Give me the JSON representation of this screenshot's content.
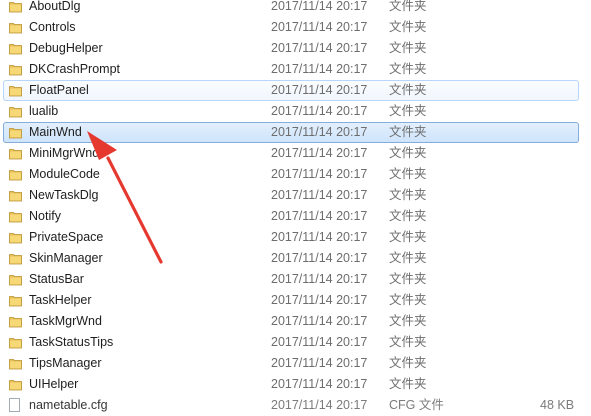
{
  "rows": [
    {
      "name": "AboutDlg",
      "date": "2017/11/14 20:17",
      "type": "文件夹",
      "size": ""
    },
    {
      "name": "Controls",
      "date": "2017/11/14 20:17",
      "type": "文件夹",
      "size": ""
    },
    {
      "name": "DebugHelper",
      "date": "2017/11/14 20:17",
      "type": "文件夹",
      "size": ""
    },
    {
      "name": "DKCrashPrompt",
      "date": "2017/11/14 20:17",
      "type": "文件夹",
      "size": ""
    },
    {
      "name": "FloatPanel",
      "date": "2017/11/14 20:17",
      "type": "文件夹",
      "size": ""
    },
    {
      "name": "lualib",
      "date": "2017/11/14 20:17",
      "type": "文件夹",
      "size": ""
    },
    {
      "name": "MainWnd",
      "date": "2017/11/14 20:17",
      "type": "文件夹",
      "size": ""
    },
    {
      "name": "MiniMgrWnd",
      "date": "2017/11/14 20:17",
      "type": "文件夹",
      "size": ""
    },
    {
      "name": "ModuleCode",
      "date": "2017/11/14 20:17",
      "type": "文件夹",
      "size": ""
    },
    {
      "name": "NewTaskDlg",
      "date": "2017/11/14 20:17",
      "type": "文件夹",
      "size": ""
    },
    {
      "name": "Notify",
      "date": "2017/11/14 20:17",
      "type": "文件夹",
      "size": ""
    },
    {
      "name": "PrivateSpace",
      "date": "2017/11/14 20:17",
      "type": "文件夹",
      "size": ""
    },
    {
      "name": "SkinManager",
      "date": "2017/11/14 20:17",
      "type": "文件夹",
      "size": ""
    },
    {
      "name": "StatusBar",
      "date": "2017/11/14 20:17",
      "type": "文件夹",
      "size": ""
    },
    {
      "name": "TaskHelper",
      "date": "2017/11/14 20:17",
      "type": "文件夹",
      "size": ""
    },
    {
      "name": "TaskMgrWnd",
      "date": "2017/11/14 20:17",
      "type": "文件夹",
      "size": ""
    },
    {
      "name": "TaskStatusTips",
      "date": "2017/11/14 20:17",
      "type": "文件夹",
      "size": ""
    },
    {
      "name": "TipsManager",
      "date": "2017/11/14 20:17",
      "type": "文件夹",
      "size": ""
    },
    {
      "name": "UIHelper",
      "date": "2017/11/14 20:17",
      "type": "文件夹",
      "size": ""
    },
    {
      "name": "nametable.cfg",
      "date": "2017/11/14 20:17",
      "type": "CFG 文件",
      "size": "48 KB"
    }
  ],
  "hover_row": "FloatPanel",
  "selected_row": "MainWnd",
  "colors": {
    "folder": "#e8c15a",
    "arrow": "#e5392f",
    "selection_border": "#84acdd",
    "hover_border": "#b8d6fb"
  },
  "icons": {
    "folder": "folder-icon",
    "file": "file-icon",
    "annotation": "red-arrow"
  }
}
